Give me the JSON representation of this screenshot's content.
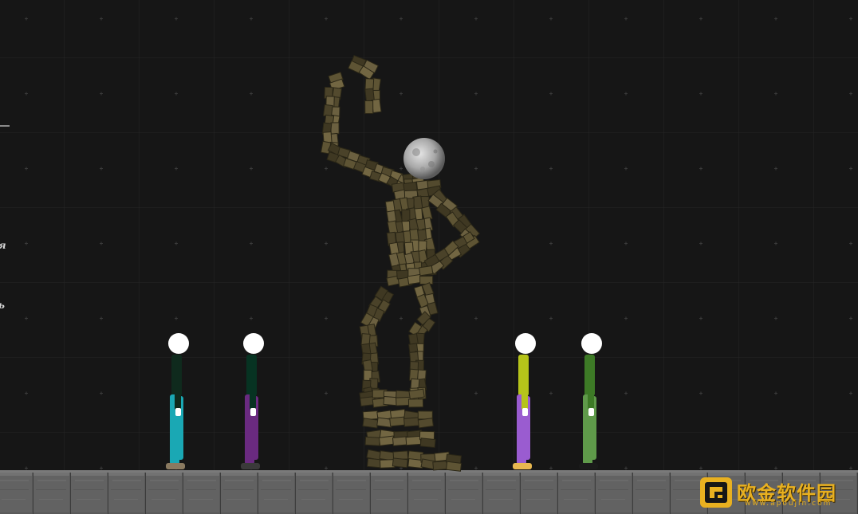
{
  "side_labels": {
    "upper": "я",
    "lower": "ь"
  },
  "watermark": {
    "title": "欧金软件园",
    "url": "www.apoujin.com",
    "icon": "apoujin-logo-icon"
  },
  "colors": {
    "background": "#161616",
    "grid": "#262626",
    "floor": "#5c5c5c",
    "statue_stone": "#5e5434",
    "watermark_gold": "#e8b020"
  },
  "scene": {
    "statue": {
      "name": "wooden-block-statue",
      "head": "metal-sphere-head"
    },
    "ragdolls": [
      {
        "name": "ragdoll-1",
        "shirt": "#0f2a1d",
        "pants": "#1aa8b4",
        "shoes": "#8a7a60"
      },
      {
        "name": "ragdoll-2",
        "shirt": "#073322",
        "pants": "#6a2a80",
        "shoes": "#3a3a3a"
      },
      {
        "name": "ragdoll-3",
        "shirt": "#b6c41a",
        "pants": "#9a5cd0",
        "shoes": "#e8b850"
      },
      {
        "name": "ragdoll-4",
        "shirt": "#3d7a26",
        "pants": "#5f9a4a",
        "shoes": "#1a1a1a"
      }
    ]
  }
}
